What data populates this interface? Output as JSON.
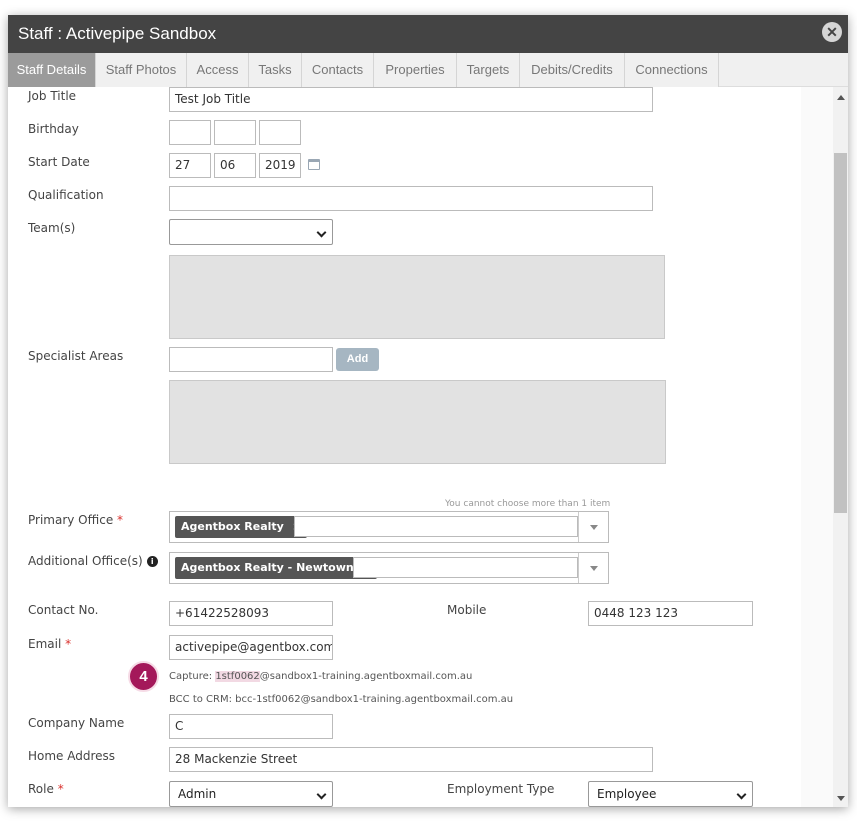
{
  "window": {
    "title": "Staff : Activepipe Sandbox"
  },
  "tabs": [
    {
      "label": "Staff Details",
      "active": true
    },
    {
      "label": "Staff Photos"
    },
    {
      "label": "Access"
    },
    {
      "label": "Tasks"
    },
    {
      "label": "Contacts"
    },
    {
      "label": "Properties"
    },
    {
      "label": "Targets"
    },
    {
      "label": "Debits/Credits"
    },
    {
      "label": "Connections"
    }
  ],
  "form": {
    "job_title": {
      "label": "Job Title",
      "value": "Test Job Title"
    },
    "birthday": {
      "label": "Birthday",
      "day": "",
      "month": "",
      "year": ""
    },
    "start_date": {
      "label": "Start Date",
      "day": "27",
      "month": "06",
      "year": "2019"
    },
    "qualification": {
      "label": "Qualification",
      "value": ""
    },
    "teams": {
      "label": "Team(s)",
      "value": ""
    },
    "specialist_areas": {
      "label": "Specialist Areas",
      "value": "",
      "add_label": "Add"
    },
    "primary_office": {
      "label": "Primary Office",
      "required": "*",
      "hint": "You cannot choose more than 1 item",
      "tag": "Agentbox Realty",
      "remove": "×"
    },
    "additional_offices": {
      "label": "Additional Office(s)",
      "info": "i",
      "tag": "Agentbox Realty - Newtown",
      "remove": "×"
    },
    "contact_no": {
      "label": "Contact No.",
      "value": "+61422528093"
    },
    "mobile": {
      "label": "Mobile",
      "value": "0448 123 123"
    },
    "email": {
      "label": "Email",
      "required": "*",
      "value": "activepipe@agentbox.com",
      "capture_prefix": "Capture: ",
      "capture_id": "1stf0062",
      "capture_suffix": "@sandbox1-training.agentboxmail.com.au",
      "bcc": "BCC to CRM: bcc-1stf0062@sandbox1-training.agentboxmail.com.au"
    },
    "company_name": {
      "label": "Company Name",
      "value": "C"
    },
    "home_address": {
      "label": "Home Address",
      "value": "28 Mackenzie Street"
    },
    "role": {
      "label": "Role",
      "required": "*",
      "value": "Admin"
    },
    "employment_type": {
      "label": "Employment Type",
      "value": "Employee"
    }
  },
  "annotation": {
    "step": "4"
  },
  "colors": {
    "titlebar": "#444444",
    "active_tab": "#9b9b9b",
    "badge": "#a4185a",
    "required": "#d9302c"
  }
}
